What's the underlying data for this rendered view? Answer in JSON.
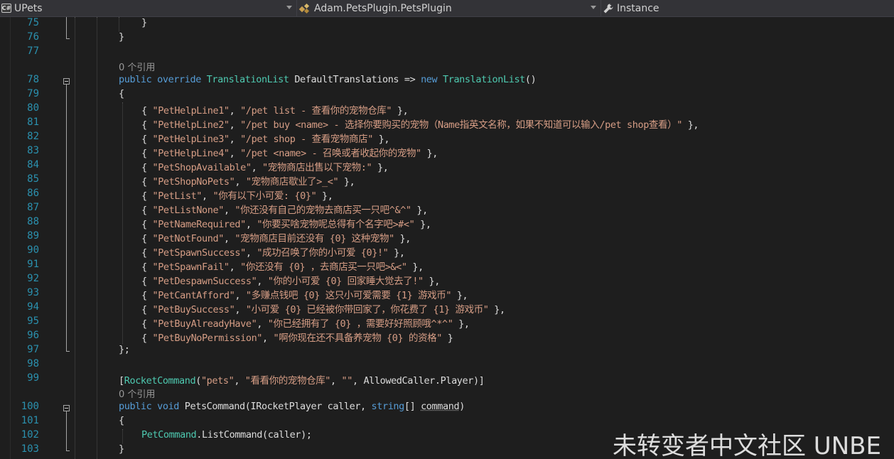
{
  "navbar": {
    "project": {
      "label": "UPets",
      "icon": "csharp-project-icon"
    },
    "class": {
      "label": "Adam.PetsPlugin.PetsPlugin",
      "icon": "class-icon"
    },
    "member": {
      "label": "Instance",
      "icon": "wrench-icon"
    }
  },
  "colors": {
    "background": "#1e1e1e",
    "line_number": "#2b91af",
    "keyword": "#569cd6",
    "type": "#4ec9b0",
    "string": "#d69d85",
    "text": "#dcdcdc",
    "codelens": "#999999"
  },
  "editor": {
    "lines": [
      {
        "num": "75",
        "parts": [
          {
            "t": "}"
          }
        ]
      },
      {
        "num": "76",
        "parts": [
          {
            "t": "}"
          }
        ]
      },
      {
        "num": "77",
        "parts": []
      },
      {
        "num": "",
        "lens": "0 个引用"
      },
      {
        "num": "78",
        "parts": [
          {
            "t": "public",
            "c": "kw"
          },
          {
            "t": " "
          },
          {
            "t": "override",
            "c": "kw"
          },
          {
            "t": " "
          },
          {
            "t": "TranslationList",
            "c": "typ"
          },
          {
            "t": " DefaultTranslations => "
          },
          {
            "t": "new",
            "c": "kw"
          },
          {
            "t": " "
          },
          {
            "t": "TranslationList",
            "c": "typ"
          },
          {
            "t": "()"
          }
        ]
      },
      {
        "num": "79",
        "parts": [
          {
            "t": "{"
          }
        ]
      },
      {
        "num": "80",
        "parts": [
          {
            "t": "{ "
          },
          {
            "t": "\"PetHelpLine1\"",
            "c": "str"
          },
          {
            "t": ", "
          },
          {
            "t": "\"/pet list - 查看你的宠物仓库\"",
            "c": "str"
          },
          {
            "t": " },"
          }
        ]
      },
      {
        "num": "81",
        "parts": [
          {
            "t": "{ "
          },
          {
            "t": "\"PetHelpLine2\"",
            "c": "str"
          },
          {
            "t": ", "
          },
          {
            "t": "\"/pet buy <name> - 选择你要购买的宠物（Name指英文名称，如果不知道可以输入/pet shop查看）\"",
            "c": "str"
          },
          {
            "t": " },"
          }
        ]
      },
      {
        "num": "82",
        "parts": [
          {
            "t": "{ "
          },
          {
            "t": "\"PetHelpLine3\"",
            "c": "str"
          },
          {
            "t": ", "
          },
          {
            "t": "\"/pet shop - 查看宠物商店\"",
            "c": "str"
          },
          {
            "t": " },"
          }
        ]
      },
      {
        "num": "83",
        "parts": [
          {
            "t": "{ "
          },
          {
            "t": "\"PetHelpLine4\"",
            "c": "str"
          },
          {
            "t": ", "
          },
          {
            "t": "\"/pet <name> - 召唤或者收起你的宠物\"",
            "c": "str"
          },
          {
            "t": " },"
          }
        ]
      },
      {
        "num": "84",
        "parts": [
          {
            "t": "{ "
          },
          {
            "t": "\"PetShopAvailable\"",
            "c": "str"
          },
          {
            "t": ", "
          },
          {
            "t": "\"宠物商店出售以下宠物:\"",
            "c": "str"
          },
          {
            "t": " },"
          }
        ]
      },
      {
        "num": "85",
        "parts": [
          {
            "t": "{ "
          },
          {
            "t": "\"PetShopNoPets\"",
            "c": "str"
          },
          {
            "t": ", "
          },
          {
            "t": "\"宠物商店歇业了>_<\"",
            "c": "str"
          },
          {
            "t": " },"
          }
        ]
      },
      {
        "num": "86",
        "parts": [
          {
            "t": "{ "
          },
          {
            "t": "\"PetList\"",
            "c": "str"
          },
          {
            "t": ", "
          },
          {
            "t": "\"你有以下小可爱: {0}\"",
            "c": "str"
          },
          {
            "t": " },"
          }
        ]
      },
      {
        "num": "87",
        "parts": [
          {
            "t": "{ "
          },
          {
            "t": "\"PetListNone\"",
            "c": "str"
          },
          {
            "t": ", "
          },
          {
            "t": "\"你还没有自己的宠物去商店买一只吧^&^\"",
            "c": "str"
          },
          {
            "t": " },"
          }
        ]
      },
      {
        "num": "88",
        "parts": [
          {
            "t": "{ "
          },
          {
            "t": "\"PetNameRequired\"",
            "c": "str"
          },
          {
            "t": ", "
          },
          {
            "t": "\"你要买啥宠物呢总得有个名字吧>#<\"",
            "c": "str"
          },
          {
            "t": " },"
          }
        ]
      },
      {
        "num": "89",
        "parts": [
          {
            "t": "{ "
          },
          {
            "t": "\"PetNotFound\"",
            "c": "str"
          },
          {
            "t": ", "
          },
          {
            "t": "\"宠物商店目前还没有 {0} 这种宠物\"",
            "c": "str"
          },
          {
            "t": " },"
          }
        ]
      },
      {
        "num": "90",
        "parts": [
          {
            "t": "{ "
          },
          {
            "t": "\"PetSpawnSuccess\"",
            "c": "str"
          },
          {
            "t": ", "
          },
          {
            "t": "\"成功召唤了你的小可爱 {0}!\"",
            "c": "str"
          },
          {
            "t": " },"
          }
        ]
      },
      {
        "num": "91",
        "parts": [
          {
            "t": "{ "
          },
          {
            "t": "\"PetSpawnFail\"",
            "c": "str"
          },
          {
            "t": ", "
          },
          {
            "t": "\"你还没有 {0} ，去商店买一只吧>&<\"",
            "c": "str"
          },
          {
            "t": " },"
          }
        ]
      },
      {
        "num": "92",
        "parts": [
          {
            "t": "{ "
          },
          {
            "t": "\"PetDespawnSuccess\"",
            "c": "str"
          },
          {
            "t": ", "
          },
          {
            "t": "\"你的小可爱 {0} 回家睡大觉去了!\"",
            "c": "str"
          },
          {
            "t": " },"
          }
        ]
      },
      {
        "num": "93",
        "parts": [
          {
            "t": "{ "
          },
          {
            "t": "\"PetCantAfford\"",
            "c": "str"
          },
          {
            "t": ", "
          },
          {
            "t": "\"多赚点钱吧 {0} 这只小可爱需要 {1} 游戏币\"",
            "c": "str"
          },
          {
            "t": " },"
          }
        ]
      },
      {
        "num": "94",
        "parts": [
          {
            "t": "{ "
          },
          {
            "t": "\"PetBuySuccess\"",
            "c": "str"
          },
          {
            "t": ", "
          },
          {
            "t": "\"小可爱 {0} 已经被你带回家了，你花费了 {1} 游戏币\"",
            "c": "str"
          },
          {
            "t": " },"
          }
        ]
      },
      {
        "num": "95",
        "parts": [
          {
            "t": "{ "
          },
          {
            "t": "\"PetBuyAlreadyHave\"",
            "c": "str"
          },
          {
            "t": ", "
          },
          {
            "t": "\"你已经拥有了 {0} ，需要好好照顾哦^*^\"",
            "c": "str"
          },
          {
            "t": " },"
          }
        ]
      },
      {
        "num": "96",
        "parts": [
          {
            "t": "{ "
          },
          {
            "t": "\"PetBuyNoPermission\"",
            "c": "str"
          },
          {
            "t": ", "
          },
          {
            "t": "\"啊你现在还不具备养宠物 {0} 的资格\"",
            "c": "str"
          },
          {
            "t": " }"
          }
        ]
      },
      {
        "num": "97",
        "parts": [
          {
            "t": "};"
          }
        ]
      },
      {
        "num": "98",
        "parts": []
      },
      {
        "num": "99",
        "parts": [
          {
            "t": "["
          },
          {
            "t": "RocketCommand",
            "c": "typ"
          },
          {
            "t": "("
          },
          {
            "t": "\"pets\"",
            "c": "str"
          },
          {
            "t": ", "
          },
          {
            "t": "\"看看你的宠物仓库\"",
            "c": "str"
          },
          {
            "t": ", "
          },
          {
            "t": "\"\"",
            "c": "str"
          },
          {
            "t": ", AllowedCaller.Player)]"
          }
        ]
      },
      {
        "num": "",
        "lens": "0 个引用"
      },
      {
        "num": "100",
        "parts": [
          {
            "t": "public",
            "c": "kw"
          },
          {
            "t": " "
          },
          {
            "t": "void",
            "c": "kw"
          },
          {
            "t": " PetsCommand(IRocketPlayer caller, "
          },
          {
            "t": "string",
            "c": "kw"
          },
          {
            "t": "[] "
          },
          {
            "t": "command",
            "c": "squig"
          },
          {
            "t": ")"
          }
        ]
      },
      {
        "num": "101",
        "parts": [
          {
            "t": "{"
          }
        ]
      },
      {
        "num": "102",
        "parts": [
          {
            "t": "PetCommand",
            "c": "typ"
          },
          {
            "t": ".ListCommand(caller);"
          }
        ]
      },
      {
        "num": "103",
        "parts": [
          {
            "t": "}"
          }
        ]
      }
    ]
  },
  "watermark": "未转变者中文社区 UNBE"
}
